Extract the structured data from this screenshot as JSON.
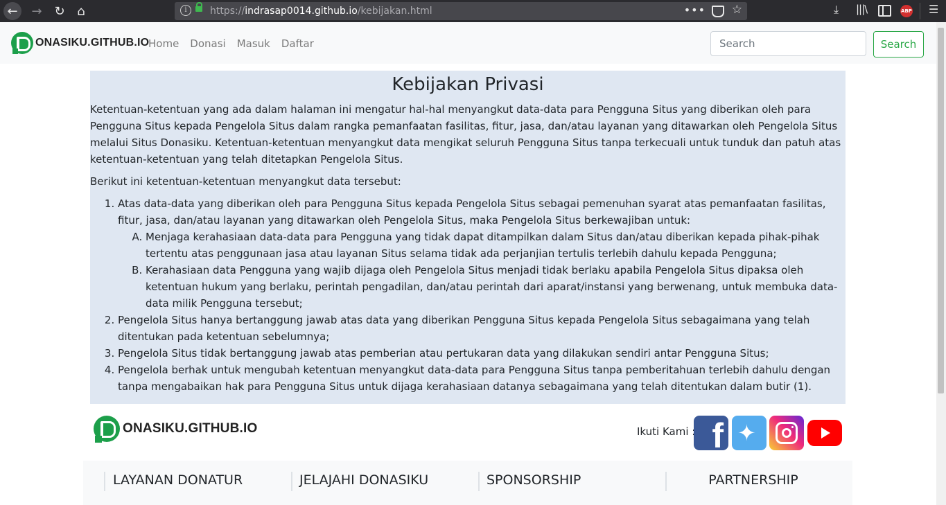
{
  "browser": {
    "url_scheme": "https://",
    "url_host": "indrasap0014.github.io",
    "url_path": "/kebijakan.html",
    "abp_label": "ABP"
  },
  "navbar": {
    "brand": "ONASIKU.GITHUB.IO",
    "links": [
      "Home",
      "Donasi",
      "Masuk",
      "Daftar"
    ],
    "search_placeholder": "Search",
    "search_button": "Search"
  },
  "content": {
    "title": "Kebijakan Privasi",
    "intro": "Ketentuan-ketentuan yang ada dalam halaman ini mengatur hal-hal menyangkut data-data para Pengguna Situs yang diberikan oleh para Pengguna Situs kepada Pengelola Situs dalam rangka pemanfaatan fasilitas, fitur, jasa, dan/atau layanan yang ditawarkan oleh Pengelola Situs melalui Situs Donasiku. Ketentuan-ketentuan menyangkut data mengikat seluruh Pengguna Situs tanpa terkecuali untuk tunduk dan patuh atas ketentuan-ketentuan yang telah ditetapkan Pengelola Situs.",
    "lead": "Berikut ini ketentuan-ketentuan menyangkut data tersebut:",
    "item1": "Atas data-data yang diberikan oleh para Pengguna Situs kepada Pengelola Situs sebagai pemenuhan syarat atas pemanfaatan fasilitas, fitur, jasa, dan/atau layanan yang ditawarkan oleh Pengelola Situs, maka Pengelola Situs berkewajiban untuk:",
    "item1_sub": [
      "Menjaga kerahasiaan data-data para Pengguna yang tidak dapat ditampilkan dalam Situs dan/atau diberikan kepada pihak-pihak tertentu atas penggunaan jasa atau layanan Situs selama tidak ada perjanjian tertulis terlebih dahulu kepada Pengguna;",
      "Kerahasiaan data Pengguna yang wajib dijaga oleh Pengelola Situs menjadi tidak berlaku apabila Pengelola Situs dipaksa oleh ketentuan hukum yang berlaku, perintah pengadilan, dan/atau perintah dari aparat/instansi yang berwenang, untuk membuka data-data milik Pengguna tersebut;"
    ],
    "item2": "Pengelola Situs hanya bertanggung jawab atas data yang diberikan Pengguna Situs kepada Pengelola Situs sebagaimana yang telah ditentukan pada ketentuan sebelumnya;",
    "item3": "Pengelola Situs tidak bertanggung jawab atas pemberian atau pertukaran data yang dilakukan sendiri antar Pengguna Situs;",
    "item4": "Pengelola berhak untuk mengubah ketentuan menyangkut data-data para Pengguna Situs tanpa pemberitahuan terlebih dahulu dengan tanpa mengabaikan hak para Pengguna Situs untuk dijaga kerahasiaan datanya sebagaimana yang telah ditentukan dalam butir (1)."
  },
  "footer": {
    "brand": "ONASIKU.GITHUB.IO",
    "follow_label": "Ikuti Kami :",
    "columns": [
      "LAYANAN DONATUR",
      "JELAJAHI DONASIKU",
      "SPONSORSHIP",
      "PARTNERSHIP"
    ]
  },
  "colors": {
    "brand_green": "#1c9f4a",
    "search_green": "#28a745",
    "content_bg": "#dfe7f2",
    "facebook": "#3b5998",
    "twitter": "#55acee",
    "youtube": "#ff0000"
  },
  "icons": [
    "back-arrow-icon",
    "forward-arrow-icon",
    "reload-icon",
    "home-icon",
    "info-icon",
    "lock-icon",
    "more-dots-icon",
    "pocket-icon",
    "star-icon",
    "download-icon",
    "library-icon",
    "sidebar-icon",
    "adblock-icon",
    "hamburger-menu-icon",
    "facebook-icon",
    "twitter-icon",
    "instagram-icon",
    "youtube-icon"
  ]
}
